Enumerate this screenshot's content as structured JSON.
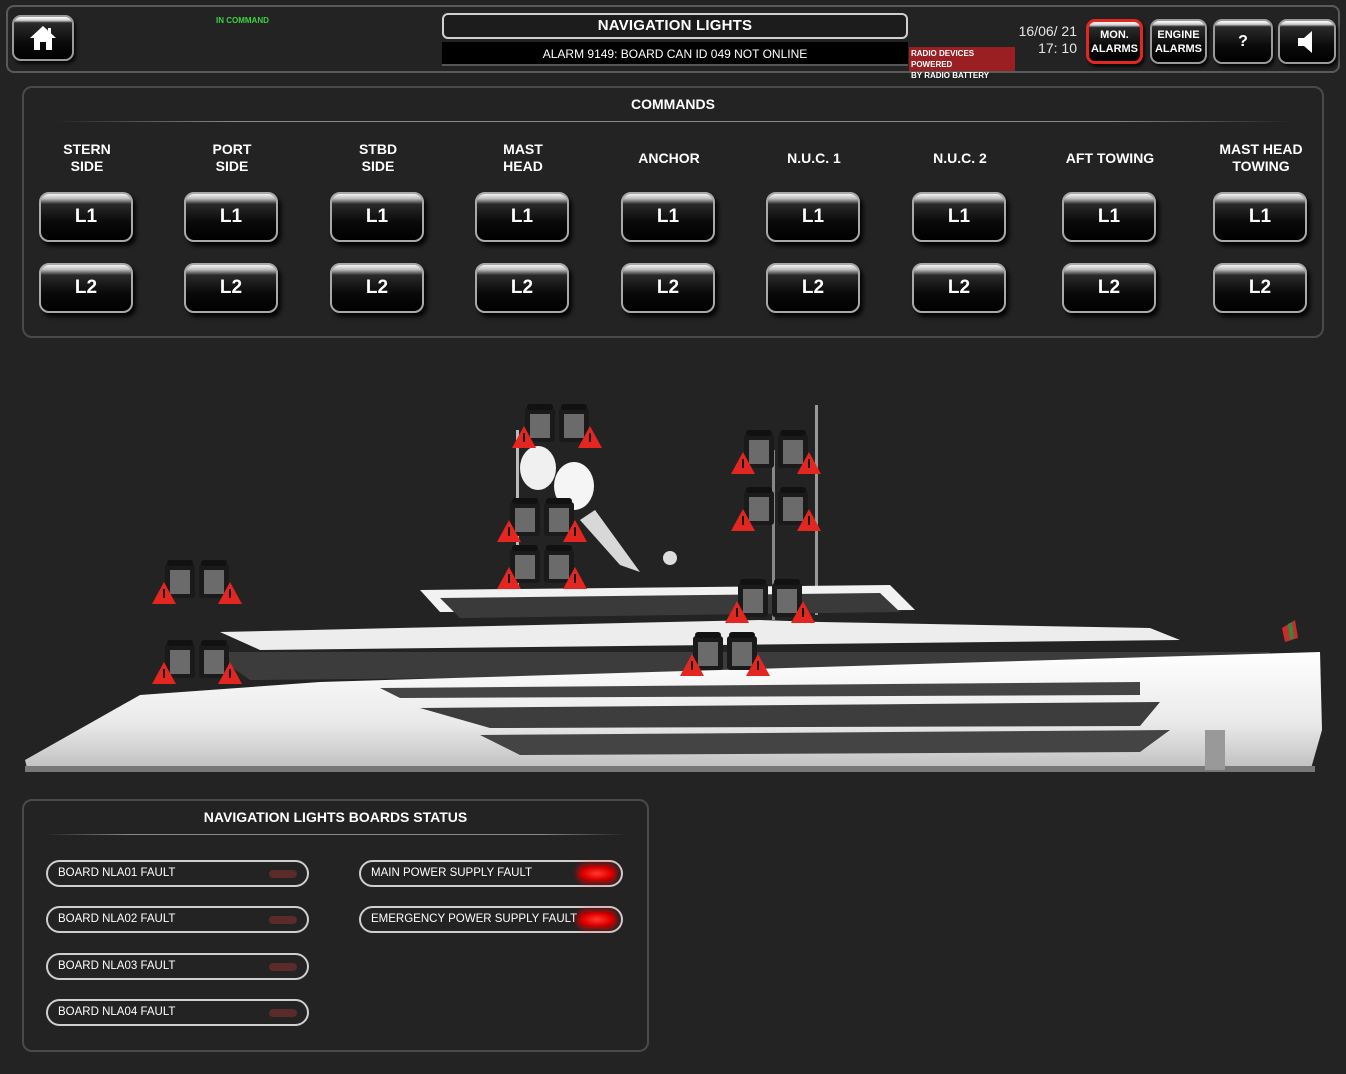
{
  "header": {
    "status": "IN COMMAND",
    "title": "NAVIGATION LIGHTS",
    "alarm": "ALARM 9149: BOARD CAN ID 049 NOT ONLINE",
    "radio_line1": "RADIO DEVICES POWERED",
    "radio_line2": "BY RADIO BATTERY",
    "date": "16/06/ 21",
    "time": "17: 10",
    "mon_alarms_line1": "MON.",
    "mon_alarms_line2": "ALARMS",
    "engine_alarms_line1": "ENGINE",
    "engine_alarms_line2": "ALARMS",
    "help": "?"
  },
  "commands": {
    "title": "COMMANDS",
    "columns": [
      {
        "label": "STERN\nSIDE",
        "l1": "L1",
        "l2": "L2"
      },
      {
        "label": "PORT\nSIDE",
        "l1": "L1",
        "l2": "L2"
      },
      {
        "label": "STBD\nSIDE",
        "l1": "L1",
        "l2": "L2"
      },
      {
        "label": "MAST\nHEAD",
        "l1": "L1",
        "l2": "L2"
      },
      {
        "label": "ANCHOR",
        "l1": "L1",
        "l2": "L2"
      },
      {
        "label": "N.U.C. 1",
        "l1": "L1",
        "l2": "L2"
      },
      {
        "label": "N.U.C. 2",
        "l1": "L1",
        "l2": "L2"
      },
      {
        "label": "AFT TOWING",
        "l1": "L1",
        "l2": "L2"
      },
      {
        "label": "MAST HEAD\nTOWING",
        "l1": "L1",
        "l2": "L2"
      }
    ]
  },
  "boards_status": {
    "title": "NAVIGATION LIGHTS BOARDS STATUS",
    "items": [
      {
        "label": "BOARD NLA01 FAULT",
        "active": false
      },
      {
        "label": "BOARD NLA02 FAULT",
        "active": false
      },
      {
        "label": "BOARD NLA03 FAULT",
        "active": false
      },
      {
        "label": "BOARD NLA04 FAULT",
        "active": false
      },
      {
        "label": "MAIN POWER SUPPLY FAULT",
        "active": true
      },
      {
        "label": "EMERGENCY POWER SUPPLY FAULT",
        "active": true
      }
    ]
  },
  "colors": {
    "alarm_red": "#e3261f",
    "status_green": "#3fd13f",
    "led_on": "#ff2a20"
  }
}
